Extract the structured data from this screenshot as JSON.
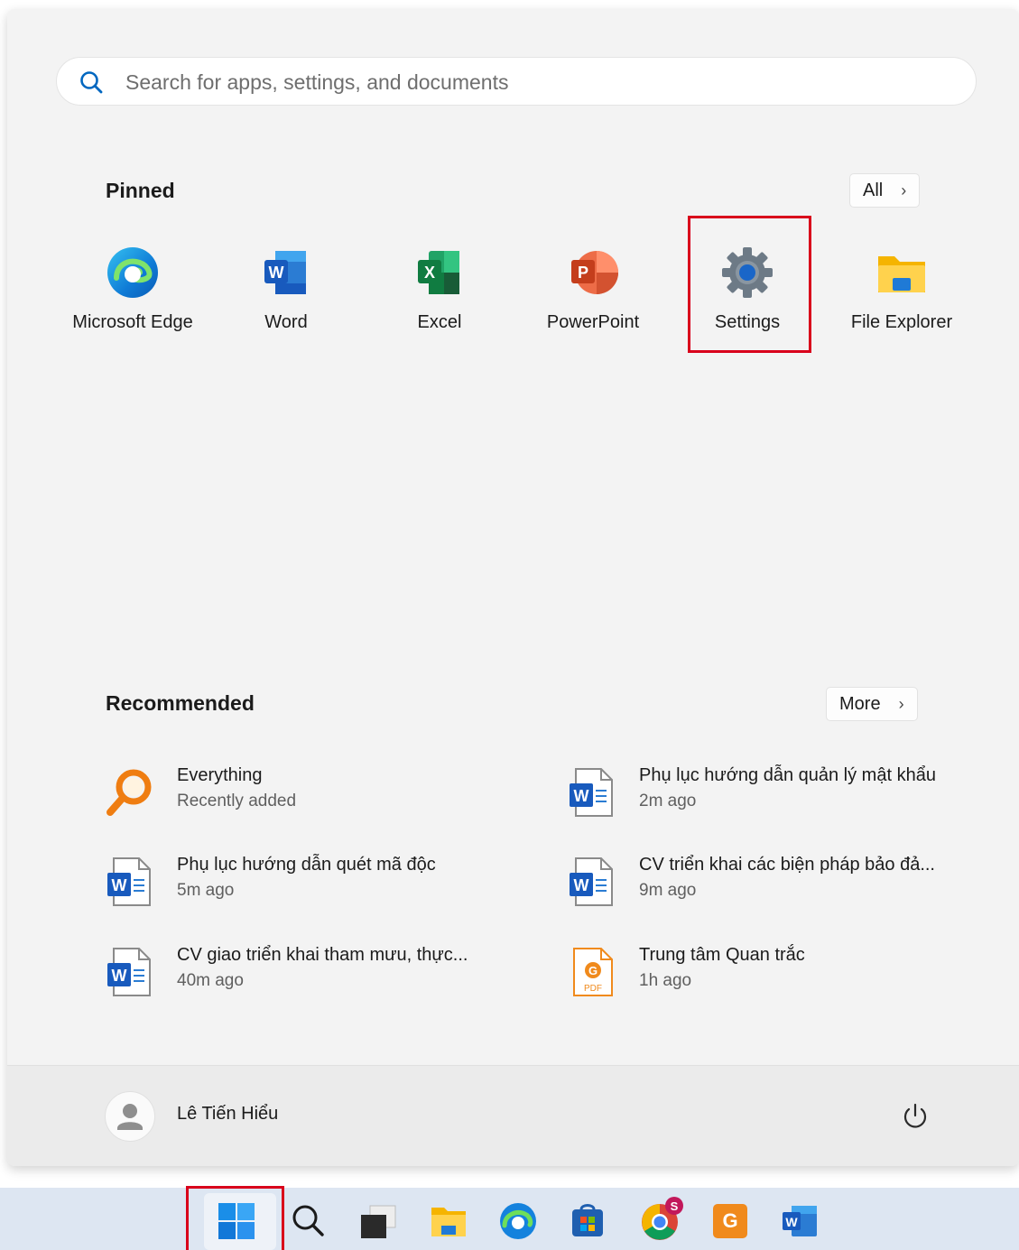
{
  "search": {
    "placeholder": "Search for apps, settings, and documents"
  },
  "pinned": {
    "title": "Pinned",
    "all_label": "All",
    "apps": [
      {
        "label": "Microsoft Edge",
        "icon": "edge-icon"
      },
      {
        "label": "Word",
        "icon": "word-icon"
      },
      {
        "label": "Excel",
        "icon": "excel-icon"
      },
      {
        "label": "PowerPoint",
        "icon": "powerpoint-icon"
      },
      {
        "label": "Settings",
        "icon": "gear-icon"
      },
      {
        "label": "File Explorer",
        "icon": "folder-icon"
      }
    ]
  },
  "recommended": {
    "title": "Recommended",
    "more_label": "More",
    "items": [
      {
        "title": "Everything",
        "subtitle": "Recently added",
        "icon": "everything-icon"
      },
      {
        "title": "Phụ lục hướng dẫn quản lý mật khẩu",
        "subtitle": "2m ago",
        "icon": "word-doc-icon"
      },
      {
        "title": "Phụ lục hướng dẫn quét mã độc",
        "subtitle": "5m ago",
        "icon": "word-doc-icon"
      },
      {
        "title": "CV triển khai các biện pháp bảo đả...",
        "subtitle": "9m ago",
        "icon": "word-doc-icon"
      },
      {
        "title": "CV giao triển khai tham mưu, thực...",
        "subtitle": "40m ago",
        "icon": "word-doc-icon"
      },
      {
        "title": "Trung tâm Quan trắc",
        "subtitle": "1h ago",
        "icon": "pdf-doc-icon"
      }
    ]
  },
  "user": {
    "name": "Lê Tiến Hiểu"
  },
  "colors": {
    "highlight": "#d9001b",
    "accent": "#0067c0"
  }
}
